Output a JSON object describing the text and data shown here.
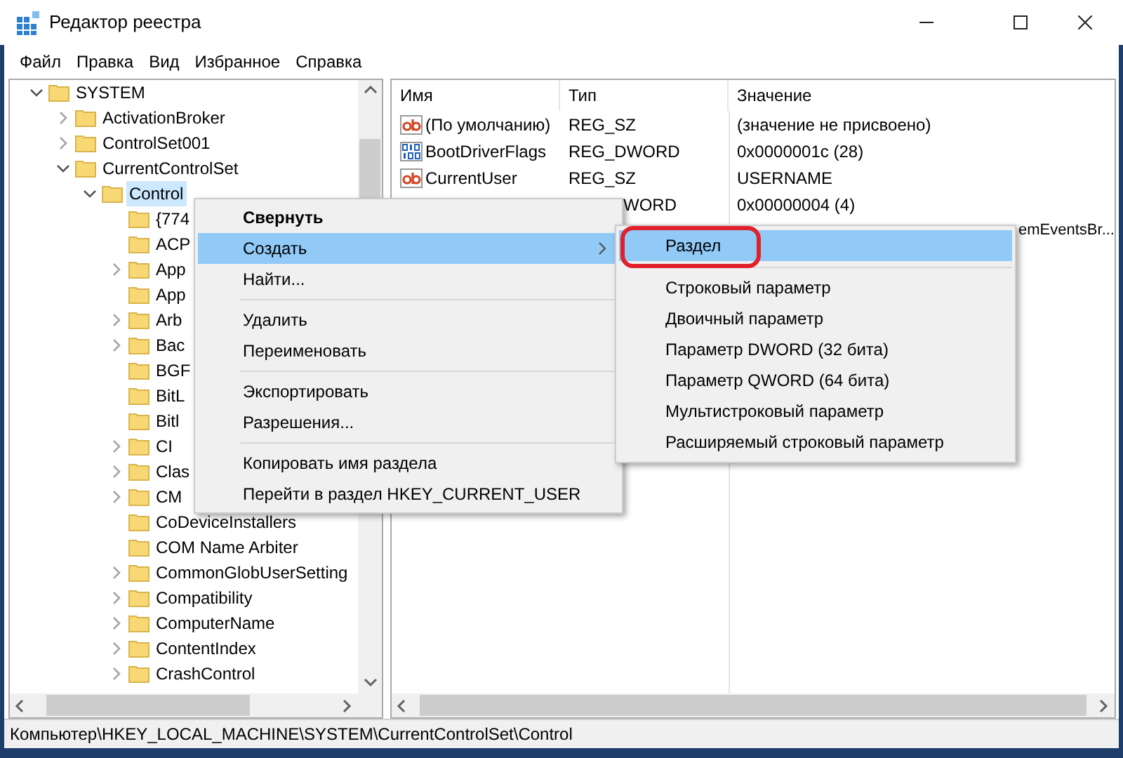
{
  "window": {
    "title": "Редактор реестра"
  },
  "menu_bar": [
    "Файл",
    "Правка",
    "Вид",
    "Избранное",
    "Справка"
  ],
  "tree": [
    {
      "label": "SYSTEM",
      "kind": "branch",
      "expanded": true,
      "selected": false,
      "children": [
        {
          "label": "ActivationBroker",
          "kind": "branch",
          "expanded": false,
          "selected": false
        },
        {
          "label": "ControlSet001",
          "kind": "branch",
          "expanded": false,
          "selected": false
        },
        {
          "label": "CurrentControlSet",
          "kind": "branch",
          "expanded": true,
          "selected": false,
          "children": [
            {
              "label": "Control",
              "kind": "branch",
              "expanded": true,
              "selected": true,
              "children": [
                {
                  "label": "{774",
                  "kind": "leaf",
                  "selected": false
                },
                {
                  "label": "ACP",
                  "kind": "leaf",
                  "selected": false
                },
                {
                  "label": "App",
                  "kind": "branch",
                  "expanded": false,
                  "selected": false
                },
                {
                  "label": "App",
                  "kind": "leaf",
                  "selected": false
                },
                {
                  "label": "Arb",
                  "kind": "branch",
                  "expanded": false,
                  "selected": false
                },
                {
                  "label": "Bac",
                  "kind": "branch",
                  "expanded": false,
                  "selected": false
                },
                {
                  "label": "BGF",
                  "kind": "leaf",
                  "selected": false
                },
                {
                  "label": "BitL",
                  "kind": "leaf",
                  "selected": false
                },
                {
                  "label": "Bitl",
                  "kind": "leaf",
                  "selected": false
                },
                {
                  "label": "CI",
                  "kind": "branch",
                  "expanded": false,
                  "selected": false
                },
                {
                  "label": "Clas",
                  "kind": "branch",
                  "expanded": false,
                  "selected": false
                },
                {
                  "label": "CM",
                  "kind": "branch",
                  "expanded": false,
                  "selected": false
                },
                {
                  "label": "CoDeviceInstallers",
                  "kind": "leaf",
                  "selected": false
                },
                {
                  "label": "COM Name Arbiter",
                  "kind": "leaf",
                  "selected": false
                },
                {
                  "label": "CommonGlobUserSetting",
                  "kind": "branch",
                  "expanded": false,
                  "selected": false
                },
                {
                  "label": "Compatibility",
                  "kind": "branch",
                  "expanded": false,
                  "selected": false
                },
                {
                  "label": "ComputerName",
                  "kind": "branch",
                  "expanded": false,
                  "selected": false
                },
                {
                  "label": "ContentIndex",
                  "kind": "branch",
                  "expanded": false,
                  "selected": false
                },
                {
                  "label": "CrashControl",
                  "kind": "branch",
                  "expanded": false,
                  "selected": false
                }
              ]
            }
          ]
        }
      ]
    }
  ],
  "table": {
    "columns": [
      "Имя",
      "Тип",
      "Значение"
    ],
    "rows": [
      {
        "kind": "string",
        "name": "(По умолчанию)",
        "type": "REG_SZ",
        "value": "(значение не присвоено)"
      },
      {
        "kind": "binary",
        "name": "BootDriverFlags",
        "type": "REG_DWORD",
        "value": "0x0000001c (28)"
      },
      {
        "kind": "string",
        "name": "CurrentUser",
        "type": "REG_SZ",
        "value": "USERNAME"
      },
      {
        "kind": "type_tail",
        "type": "WORD",
        "value": "0x00000004 (4)"
      },
      {
        "kind": "value_tail",
        "value": "emEventsBr..."
      }
    ]
  },
  "context_menu": {
    "items": [
      {
        "kind": "item",
        "label": "Свернуть",
        "default": true,
        "selected": false,
        "submenu": false
      },
      {
        "kind": "item",
        "label": "Создать",
        "default": false,
        "selected": true,
        "submenu": true
      },
      {
        "kind": "item",
        "label": "Найти...",
        "default": false,
        "selected": false,
        "submenu": false
      },
      {
        "kind": "separator"
      },
      {
        "kind": "item",
        "label": "Удалить",
        "default": false,
        "selected": false,
        "submenu": false
      },
      {
        "kind": "item",
        "label": "Переименовать",
        "default": false,
        "selected": false,
        "submenu": false
      },
      {
        "kind": "separator"
      },
      {
        "kind": "item",
        "label": "Экспортировать",
        "default": false,
        "selected": false,
        "submenu": false
      },
      {
        "kind": "item",
        "label": "Разрешения...",
        "default": false,
        "selected": false,
        "submenu": false
      },
      {
        "kind": "separator"
      },
      {
        "kind": "item",
        "label": "Копировать имя раздела",
        "default": false,
        "selected": false,
        "submenu": false
      },
      {
        "kind": "item",
        "label": "Перейти в раздел HKEY_CURRENT_USER",
        "default": false,
        "selected": false,
        "submenu": false
      }
    ]
  },
  "submenu": {
    "items": [
      {
        "kind": "item",
        "label": "Раздел",
        "selected": true,
        "annotated": true
      },
      {
        "kind": "separator"
      },
      {
        "kind": "item",
        "label": "Строковый параметр",
        "selected": false,
        "annotated": false
      },
      {
        "kind": "item",
        "label": "Двоичный параметр",
        "selected": false,
        "annotated": false
      },
      {
        "kind": "item",
        "label": "Параметр DWORD (32 бита)",
        "selected": false,
        "annotated": false
      },
      {
        "kind": "item",
        "label": "Параметр QWORD (64 бита)",
        "selected": false,
        "annotated": false
      },
      {
        "kind": "item",
        "label": "Мультистроковый параметр",
        "selected": false,
        "annotated": false
      },
      {
        "kind": "item",
        "label": "Расширяемый строковый параметр",
        "selected": false,
        "annotated": false
      }
    ]
  },
  "status_bar": "Компьютер\\HKEY_LOCAL_MACHINE\\SYSTEM\\CurrentControlSet\\Control"
}
